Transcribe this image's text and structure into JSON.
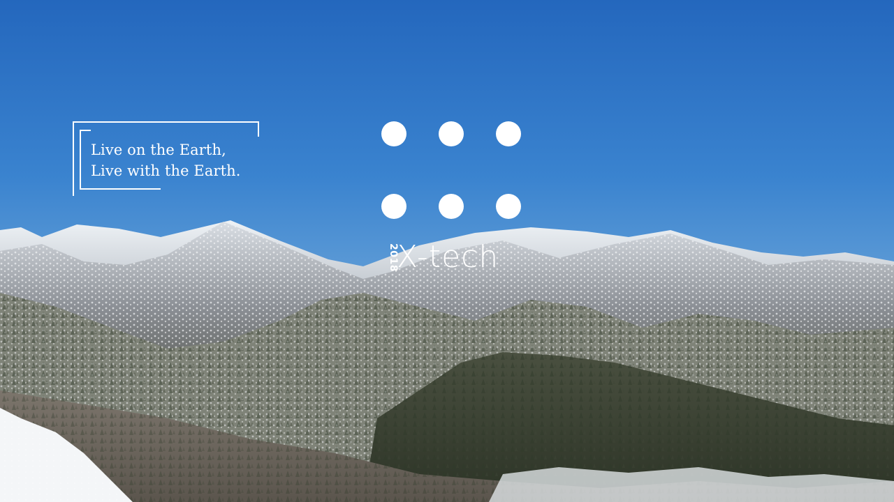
{
  "tagline": {
    "line1": "Live on the Earth,",
    "line2": "Live with the Earth."
  },
  "logo": {
    "dots": 6,
    "year": "2018",
    "name": "X-tech"
  },
  "colors": {
    "sky_top": "#2a6fc2",
    "sky_bottom": "#6aa3d6",
    "text": "#ffffff"
  }
}
